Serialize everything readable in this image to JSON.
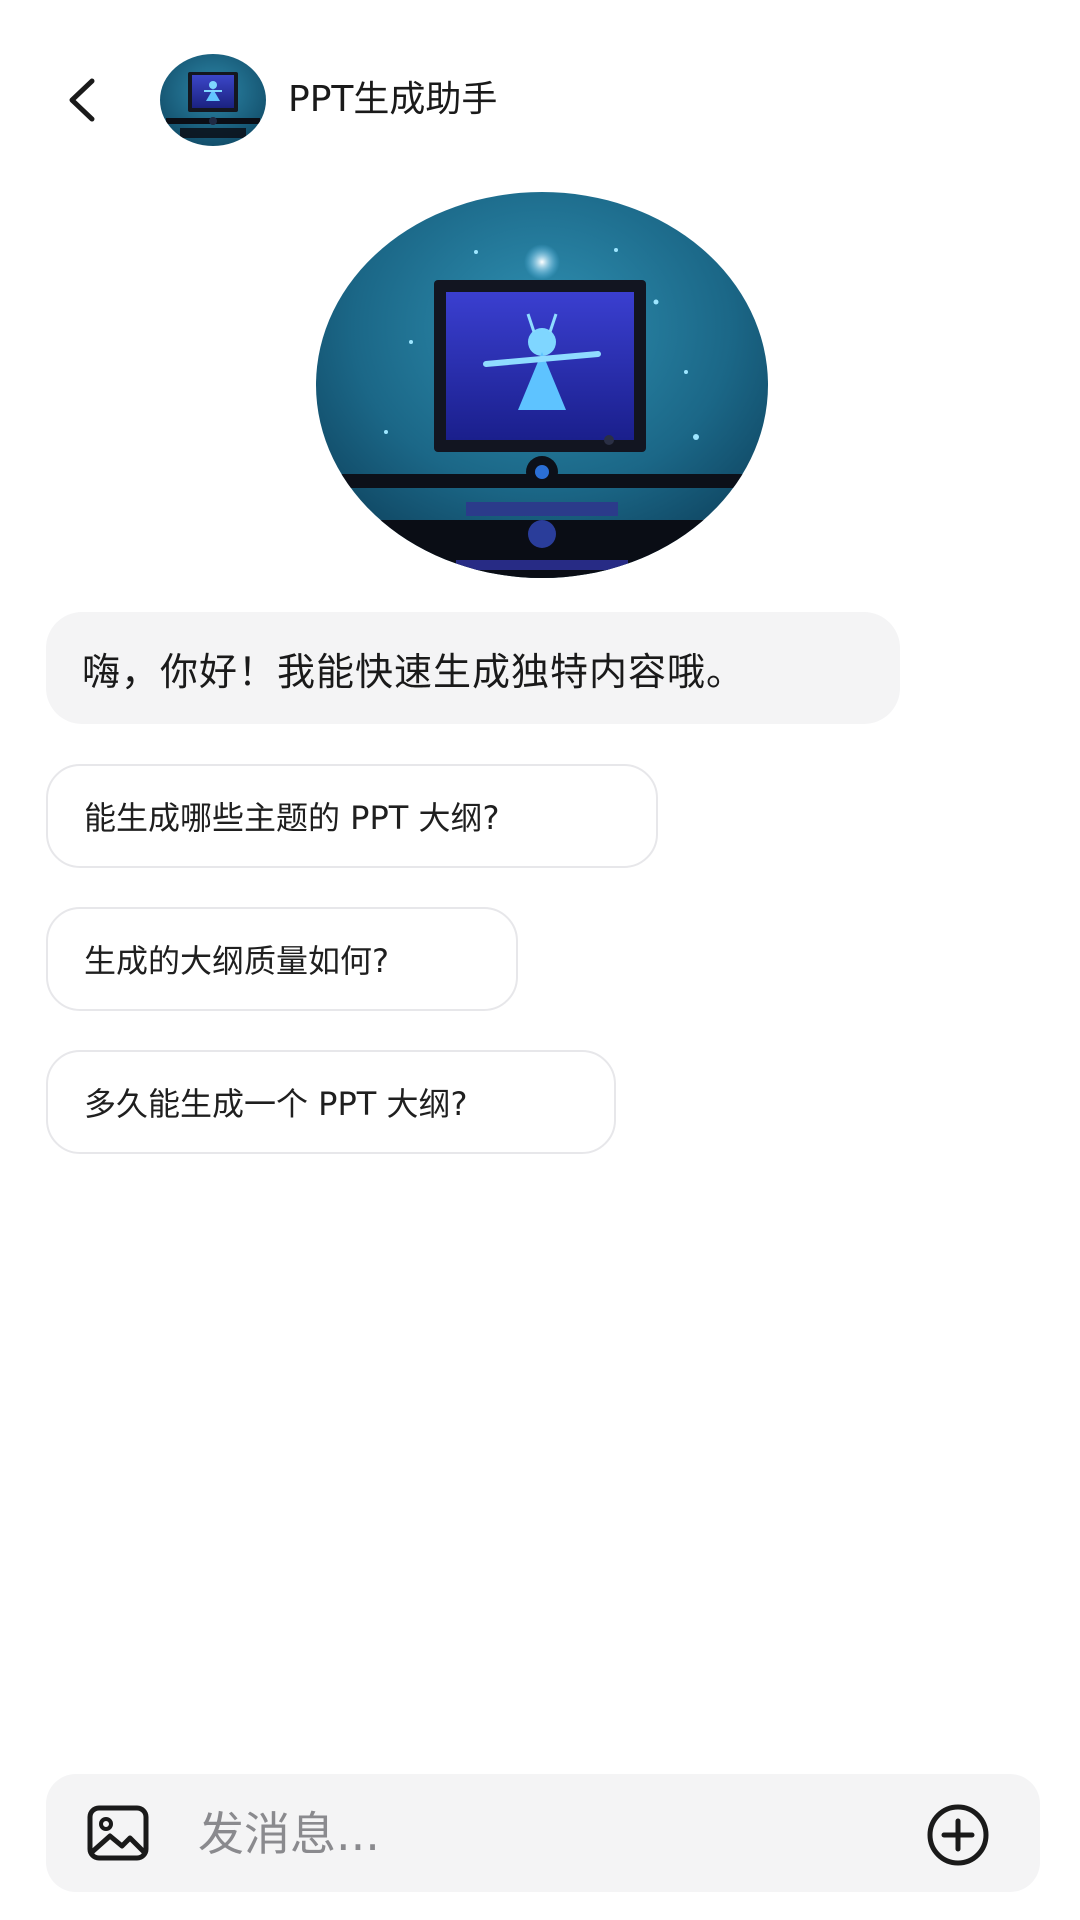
{
  "header": {
    "title": "PPT生成助手",
    "back_icon": "chevron-left-icon",
    "avatar": "bot-avatar"
  },
  "hero": {
    "avatar": "bot-avatar-large"
  },
  "greeting": {
    "text": "嗨，你好！我能快速生成独特内容哦。"
  },
  "suggestions": [
    {
      "text": "能生成哪些主题的 PPT 大纲?"
    },
    {
      "text": "生成的大纲质量如何?"
    },
    {
      "text": "多久能生成一个 PPT 大纲?"
    }
  ],
  "composer": {
    "placeholder": "发消息...",
    "image_icon": "image-icon",
    "plus_icon": "plus-circle-icon"
  },
  "colors": {
    "background": "#ffffff",
    "bubble": "#f4f4f5",
    "border": "#e7e7ea",
    "text": "#1a1a1a",
    "placeholder": "#8a8a8e",
    "avatar_bg": "#1f6a86",
    "avatar_glow": "#55c8ff"
  }
}
